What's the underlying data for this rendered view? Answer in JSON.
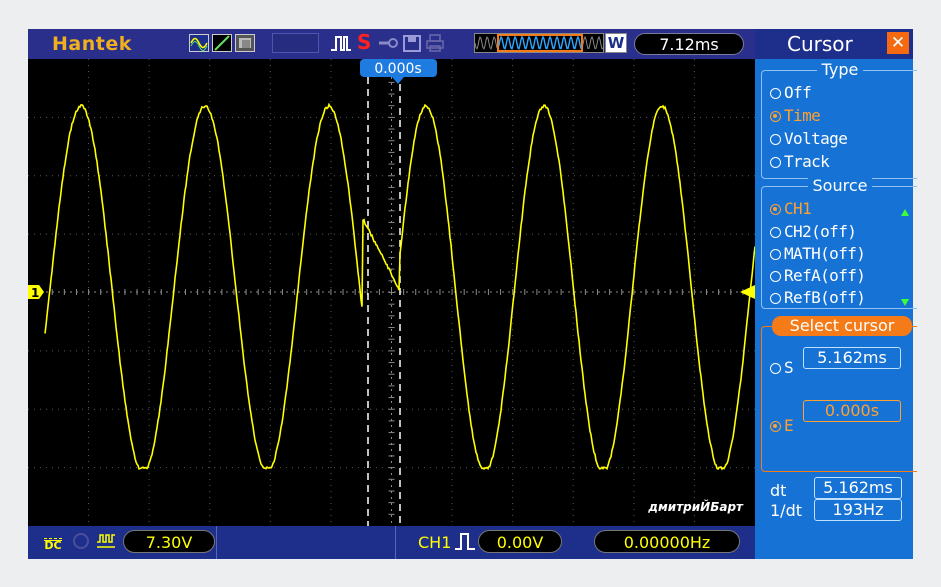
{
  "brand": "Hantek",
  "toolbar": {
    "icons": [
      "waveform-icon",
      "slope-icon",
      "persist-icon",
      "pulse-icon",
      "stop-icon",
      "probe-icon",
      "save-icon",
      "print-icon",
      "memory-waveform-icon",
      "window-icon"
    ],
    "stop_label": "S",
    "window_label": "W",
    "timebase": "7.12ms",
    "trigger_time": "0.000s"
  },
  "colors": {
    "trace": "#ffff00",
    "panel": "#1673d5",
    "dark_blue": "#1d2f8a",
    "orange": "#f57a18",
    "selected": "#ffa030"
  },
  "display": {
    "channel_marker": "1",
    "watermark": "дмитриЙБарт"
  },
  "panel": {
    "title": "Cursor",
    "close_label": "✕",
    "type": {
      "label": "Type",
      "options": [
        "Off",
        "Time",
        "Voltage",
        "Track"
      ],
      "selected": "Time"
    },
    "source": {
      "label": "Source",
      "options": [
        "CH1",
        "CH2(off)",
        "MATH(off)",
        "RefA(off)",
        "RefB(off)"
      ],
      "selected": "CH1"
    },
    "select_cursor": {
      "label": "Select cursor",
      "s_label": "S",
      "s_value": "5.162ms",
      "e_label": "E",
      "e_value": "0.000s",
      "selected": "E"
    },
    "readout": {
      "dt_label": "dt",
      "dt_value": "5.162ms",
      "inv_label": "1/dt",
      "inv_value": "193Hz"
    }
  },
  "status": {
    "coupling": "DC",
    "ch1_scale": "7.30V",
    "trigger_channel": "CH1",
    "trigger_level": "0.00V",
    "frequency": "0.00000Hz"
  }
}
